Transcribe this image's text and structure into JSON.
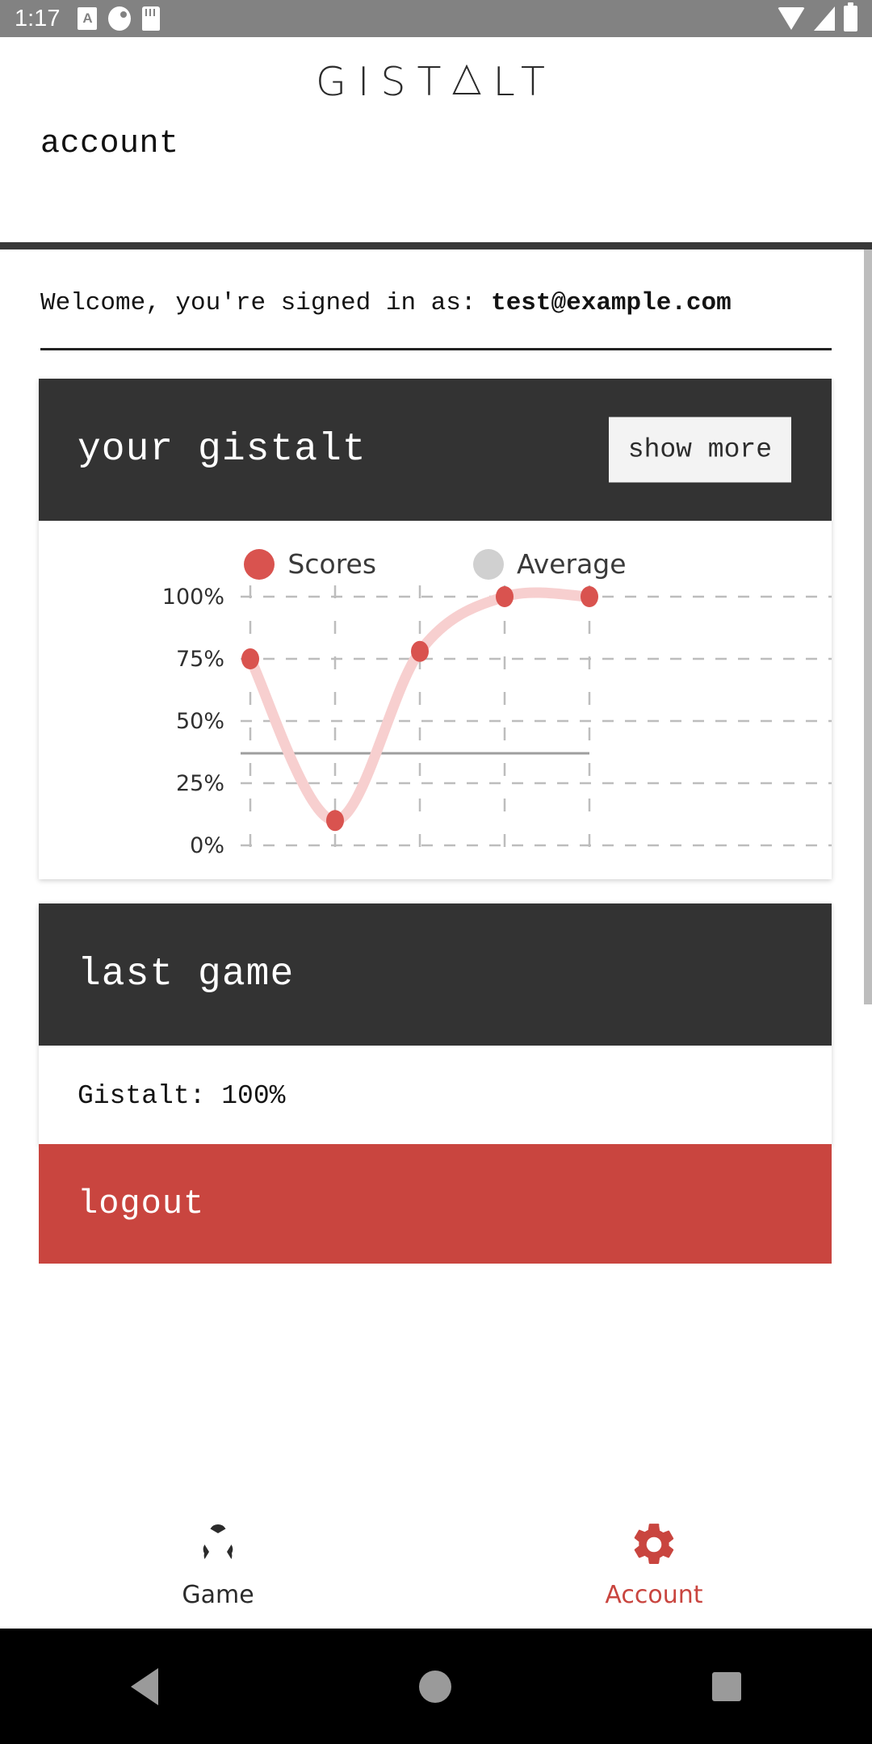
{
  "statusbar": {
    "time": "1:17",
    "app_icon_letter": "A",
    "icons": [
      "app-info-icon",
      "notification-dot-icon",
      "sdcard-icon",
      "wifi-icon",
      "signal-icon",
      "battery-icon"
    ]
  },
  "brand": {
    "part1": "GIST",
    "part2": "LT",
    "full": "GISTALT"
  },
  "header": {
    "page_title": "account"
  },
  "welcome": {
    "prefix": "Welcome, you're signed in as: ",
    "email": "test@example.com"
  },
  "gistalt_card": {
    "title": "your gistalt",
    "show_more_label": "show more"
  },
  "chart_data": {
    "type": "line",
    "title": "your gistalt",
    "xlabel": "",
    "ylabel": "",
    "ylim": [
      0,
      100
    ],
    "ytick_labels": [
      "100%",
      "75%",
      "50%",
      "25%",
      "0%"
    ],
    "ytick_values": [
      100,
      75,
      50,
      25,
      0
    ],
    "grid": true,
    "legend_position": "top-center",
    "series": [
      {
        "name": "Scores",
        "color": "#d9534f",
        "line_color": "#f7cfcf",
        "x": [
          1,
          2,
          3,
          4,
          5
        ],
        "values": [
          75,
          10,
          78,
          100,
          100
        ]
      },
      {
        "name": "Average",
        "color": "#d0d0d0",
        "line_color": "#9e9e9e",
        "type": "horizontal-line",
        "value": 37
      }
    ]
  },
  "last_game_card": {
    "title": "last game",
    "score_text": "Gistalt: 100%"
  },
  "logout": {
    "label": "logout"
  },
  "bottom_nav": {
    "items": [
      {
        "label": "Game",
        "icon": "kanizsa-triangle-icon",
        "active": false
      },
      {
        "label": "Account",
        "icon": "gear-icon",
        "active": true
      }
    ]
  },
  "system_nav": {
    "back": "back-button",
    "home": "home-button",
    "recents": "recents-button"
  },
  "colors": {
    "accent_red": "#c9453f",
    "marker_red": "#d9534f",
    "line_pink": "#f7cfcf",
    "average_gray": "#d0d0d0",
    "dark_panel": "#333333",
    "statusbar_gray": "#828282"
  }
}
